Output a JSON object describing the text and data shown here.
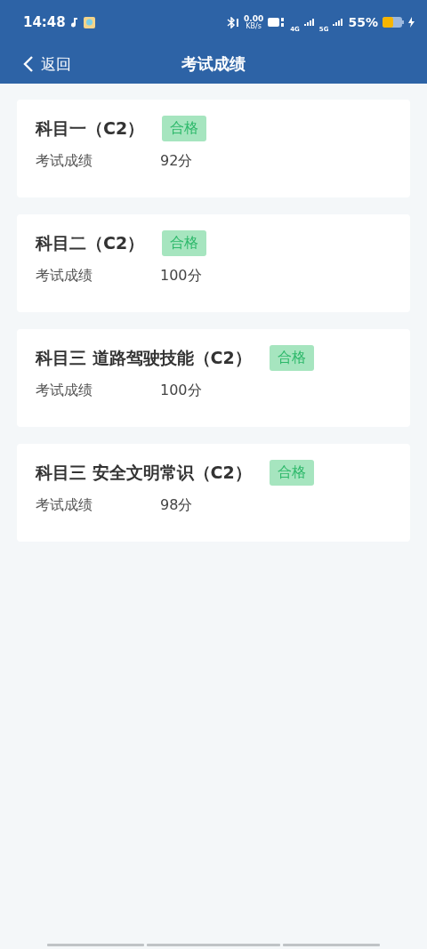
{
  "status_bar": {
    "time": "14:48",
    "net_speed": "0.00",
    "net_unit": "KB/s",
    "sim_1": "4G",
    "sim_2": "5G",
    "battery": "55%"
  },
  "header": {
    "back": "返回",
    "title": "考试成绩"
  },
  "results": [
    {
      "subject": "科目一（C2）",
      "status": "合格",
      "label": "考试成绩",
      "score": "92分"
    },
    {
      "subject": "科目二（C2）",
      "status": "合格",
      "label": "考试成绩",
      "score": "100分"
    },
    {
      "subject": "科目三 道路驾驶技能（C2）",
      "status": "合格",
      "label": "考试成绩",
      "score": "100分"
    },
    {
      "subject": "科目三 安全文明常识（C2）",
      "status": "合格",
      "label": "考试成绩",
      "score": "98分"
    }
  ]
}
